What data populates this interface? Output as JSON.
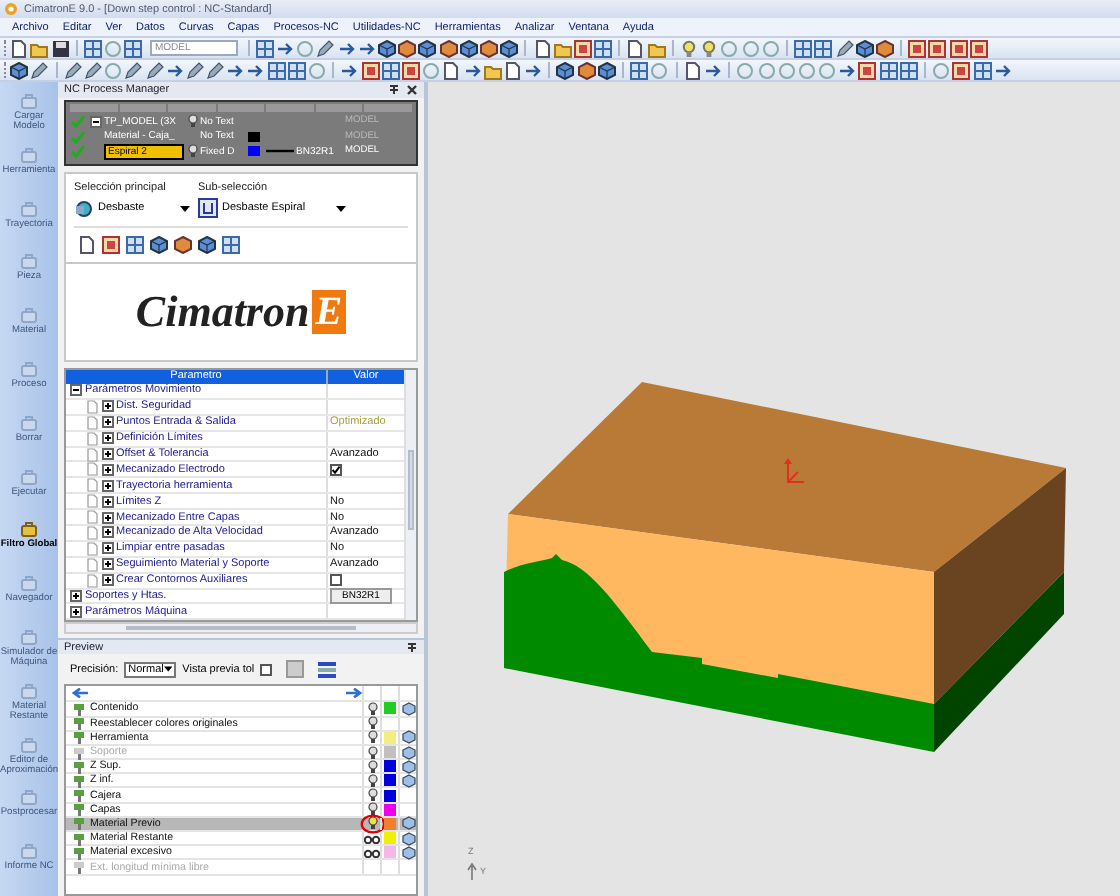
{
  "window": {
    "title": "CimatronE 9.0 - [Down step control : NC-Standard]"
  },
  "menu": [
    "Archivo",
    "Editar",
    "Ver",
    "Datos",
    "Curvas",
    "Capas",
    "Procesos-NC",
    "Utilidades-NC",
    "Herramientas",
    "Analizar",
    "Ventana",
    "Ayuda"
  ],
  "toolbar": {
    "model_combo": "MODEL"
  },
  "sidebar": {
    "items": [
      {
        "label": "Cargar Modelo",
        "disabled": true
      },
      {
        "label": "Herramienta",
        "disabled": true
      },
      {
        "label": "Trayectoria",
        "disabled": true
      },
      {
        "label": "Pieza",
        "disabled": true
      },
      {
        "label": "Material",
        "disabled": true
      },
      {
        "label": "Proceso",
        "disabled": true
      },
      {
        "label": "Borrar",
        "disabled": true
      },
      {
        "label": "Ejecutar",
        "disabled": true
      },
      {
        "label": "Filtro Global",
        "disabled": false
      },
      {
        "label": "Navegador",
        "disabled": true
      },
      {
        "label": "Simulador de Máquina",
        "disabled": true
      },
      {
        "label": "Material Restante",
        "disabled": true
      },
      {
        "label": "Editor de Aproximación",
        "disabled": true
      },
      {
        "label": "Postprocesar",
        "disabled": true
      },
      {
        "label": "Informe NC",
        "disabled": true
      }
    ]
  },
  "process_manager": {
    "title": "NC Process Manager",
    "rows": [
      {
        "name": "TP_MODEL (3X",
        "expanded": true,
        "text": "No Text",
        "model": "MODEL",
        "selected": false
      },
      {
        "name": "Material - Caja_",
        "text": "No Text",
        "color": "#000000",
        "model": "MODEL",
        "selected": false
      },
      {
        "name": "Espiral 2",
        "text": "Fixed D",
        "color": "#0000ff",
        "tool": "BN32R1",
        "model": "MODEL",
        "selected": true
      }
    ],
    "main_selection": {
      "label": "Selección principal",
      "value": "Desbaste"
    },
    "sub_selection": {
      "label": "Sub-selección",
      "value": "Desbaste Espiral"
    },
    "logo": {
      "text": "Cimatron",
      "mark": "E"
    },
    "parameters": {
      "columns": [
        "Parametro",
        "Valor"
      ],
      "rows": [
        {
          "label": "Parámetros Movimiento",
          "expanded": true,
          "children": [
            {
              "label": "Dist. Seguridad",
              "expanded": false
            },
            {
              "label": "Puntos Entrada & Salida",
              "expanded": false,
              "value": "Optimizado",
              "kind": "text",
              "dimmed": true
            },
            {
              "label": "Definición Límites",
              "expanded": false
            },
            {
              "label": "Offset & Tolerancia",
              "expanded": false,
              "value": "Avanzado",
              "kind": "text",
              "dimmed": false
            },
            {
              "label": "Mecanizado Electrodo",
              "expanded": false,
              "kind": "check",
              "checked": true
            },
            {
              "label": "Trayectoria herramienta",
              "expanded": false
            },
            {
              "label": "Límites Z",
              "expanded": false,
              "value": "No",
              "kind": "text",
              "dimmed": false
            },
            {
              "label": "Mecanizado Entre Capas",
              "expanded": false,
              "value": "No",
              "kind": "text",
              "dimmed": false
            },
            {
              "label": "Mecanizado de Alta Velocidad",
              "expanded": false,
              "value": "Avanzado",
              "kind": "text",
              "dimmed": false
            },
            {
              "label": "Limpiar entre pasadas",
              "expanded": false,
              "value": "No",
              "kind": "text",
              "dimmed": false
            },
            {
              "label": "Seguimiento Material y Soporte",
              "expanded": false,
              "value": "Avanzado",
              "kind": "text",
              "dimmed": false
            },
            {
              "label": "Crear Contornos Auxiliares",
              "expanded": false,
              "kind": "check",
              "checked": false
            }
          ]
        },
        {
          "label": "Soportes y Htas.",
          "expanded": false,
          "value": "BN32R1",
          "kind": "button"
        },
        {
          "label": "Parámetros Máquina",
          "expanded": false
        }
      ]
    }
  },
  "preview": {
    "title": "Preview",
    "precision_label": "Precisión:",
    "precision": "Normal",
    "tol_label": "Vista previa tol",
    "tol_checked": false,
    "items": [
      {
        "label": "Contenido",
        "kind": "lamp",
        "color": "#22cc22",
        "cube": true,
        "disabled": false,
        "selected": false
      },
      {
        "label": "Reestablecer colores originales",
        "kind": "lamp",
        "cube": false,
        "disabled": false,
        "selected": false
      },
      {
        "label": "Herramienta",
        "kind": "lamp",
        "color": "#f4ee80",
        "cube": true,
        "disabled": false,
        "selected": false
      },
      {
        "label": "Soporte",
        "kind": "lamp",
        "color": "#c0c0c0",
        "cube": true,
        "disabled": true,
        "selected": false
      },
      {
        "label": "Z Sup.",
        "kind": "lamp",
        "color": "#0000dd",
        "cube": true,
        "disabled": false,
        "selected": false
      },
      {
        "label": "Z inf.",
        "kind": "lamp",
        "color": "#0000dd",
        "cube": true,
        "disabled": false,
        "selected": false
      },
      {
        "label": "Cajera",
        "kind": "lamp",
        "color": "#0000dd",
        "cube": false,
        "disabled": false,
        "selected": false
      },
      {
        "label": "Capas",
        "kind": "lamp",
        "color": "#ee00ee",
        "cube": false,
        "disabled": false,
        "selected": false
      },
      {
        "label": "Material Previo",
        "kind": "lamp",
        "color": "#f08030",
        "cube": true,
        "disabled": false,
        "selected": true
      },
      {
        "label": "Material Restante",
        "kind": "glasses",
        "color": "#f0f000",
        "cube": true,
        "disabled": false,
        "selected": false
      },
      {
        "label": "Material excesivo",
        "kind": "glasses",
        "color": "#f4b8e8",
        "cube": true,
        "disabled": false,
        "selected": false
      },
      {
        "label": "Ext. longitud mínima libre",
        "kind": "none",
        "cube": false,
        "disabled": true,
        "selected": false
      }
    ]
  },
  "viewport": {
    "axis_labels": [
      "Z",
      "Y"
    ]
  }
}
